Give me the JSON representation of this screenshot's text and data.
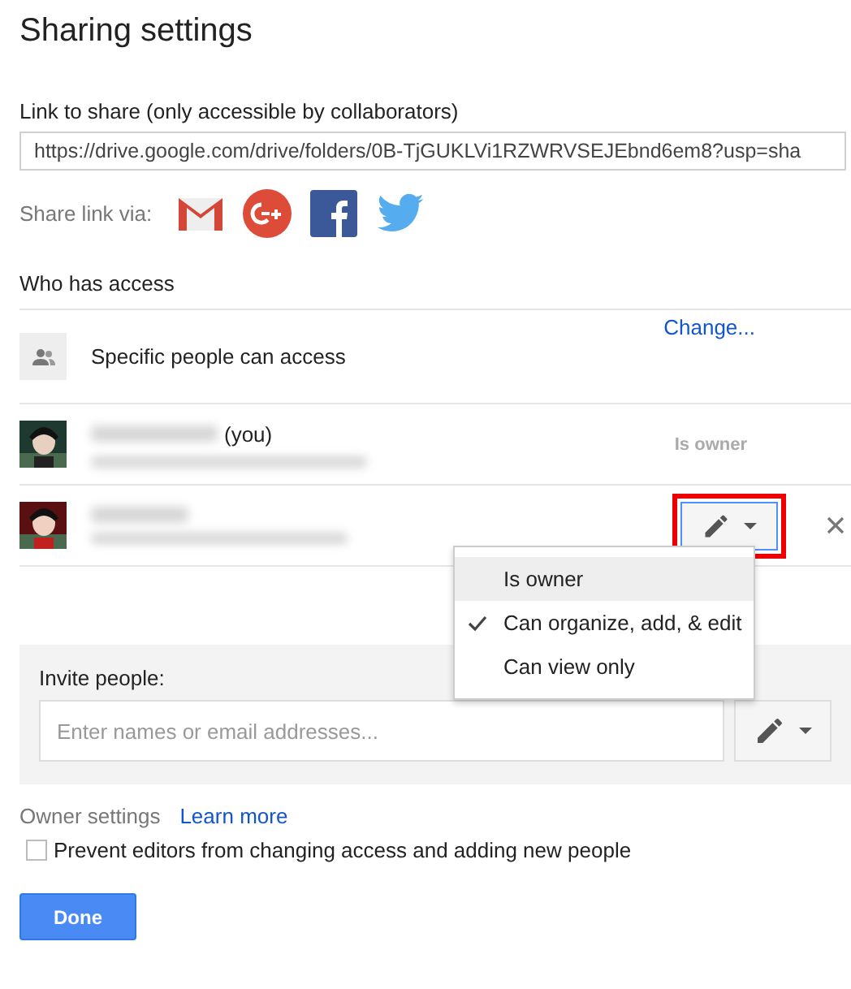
{
  "title": "Sharing settings",
  "link": {
    "label": "Link to share (only accessible by collaborators)",
    "value": "https://drive.google.com/drive/folders/0B-TjGUKLVi1RZWRVSEJEbnd6em8?usp=sha"
  },
  "share_via": {
    "label": "Share link via:",
    "services": [
      {
        "kind": "gmail"
      },
      {
        "kind": "gplus"
      },
      {
        "kind": "facebook"
      },
      {
        "kind": "twitter"
      }
    ]
  },
  "access": {
    "heading": "Who has access",
    "general": {
      "text": "Specific people can access",
      "action": "Change..."
    },
    "people": [
      {
        "suffix": "(you)",
        "role": "Is owner",
        "kind": "owner"
      },
      {
        "kind": "editor",
        "role_menu_open": true,
        "annotated": true
      }
    ]
  },
  "role_menu": [
    {
      "label": "Is owner",
      "selected": false,
      "highlighted": true
    },
    {
      "label": "Can organize, add, & edit",
      "selected": true,
      "highlighted": false
    },
    {
      "label": "Can view only",
      "selected": false,
      "highlighted": false
    }
  ],
  "invite": {
    "label": "Invite people:",
    "placeholder": "Enter names or email addresses..."
  },
  "owner_settings": {
    "label": "Owner settings",
    "link": "Learn more",
    "option": {
      "label": "Prevent editors from changing access and adding new people",
      "checked": false
    }
  },
  "buttons": [
    {
      "label": "Done"
    }
  ]
}
